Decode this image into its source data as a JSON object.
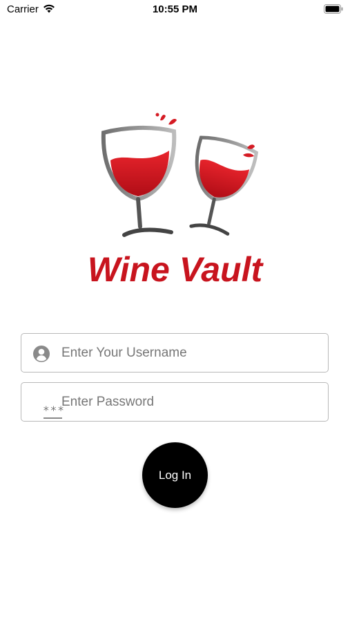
{
  "status_bar": {
    "carrier": "Carrier",
    "time": "10:55 PM",
    "wifi_icon": "wifi-icon",
    "battery_icon": "battery-icon"
  },
  "logo": {
    "icon": "wine-glasses-icon",
    "title": "Wine Vault",
    "brand_color": "#c8141e"
  },
  "login_form": {
    "username": {
      "icon": "user-avatar-icon",
      "placeholder": "Enter Your Username",
      "value": ""
    },
    "password": {
      "icon": "password-icon",
      "icon_text": "***",
      "placeholder": "Enter Password",
      "value": ""
    },
    "submit_label": "Log In"
  }
}
